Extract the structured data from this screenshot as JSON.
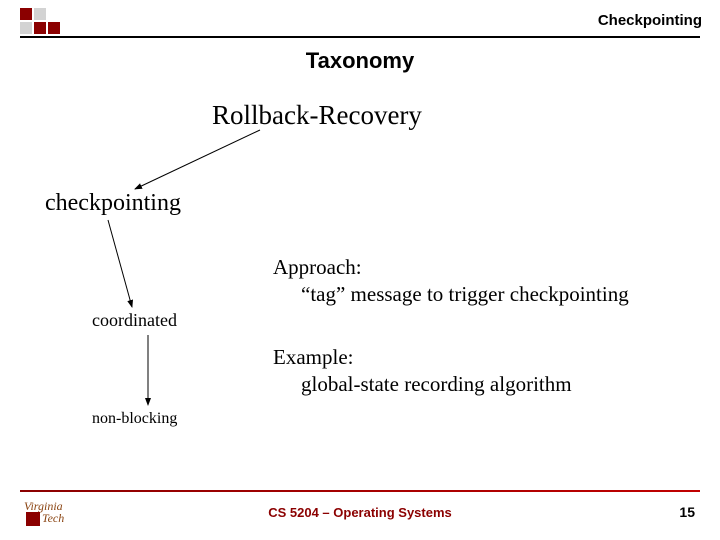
{
  "header": {
    "topic": "Checkpointing",
    "title": "Taxonomy"
  },
  "tree": {
    "root": "Rollback-Recovery",
    "level1": "checkpointing",
    "level2": "coordinated",
    "level3": "non-blocking"
  },
  "approach": {
    "label": "Approach:",
    "text": "“tag” message to trigger checkpointing"
  },
  "example": {
    "label": "Example:",
    "text": "global-state recording algorithm"
  },
  "footer": {
    "course": "CS 5204 – Operating Systems",
    "page": "15",
    "institution_top": "Virginia",
    "institution_bottom": "Tech"
  }
}
